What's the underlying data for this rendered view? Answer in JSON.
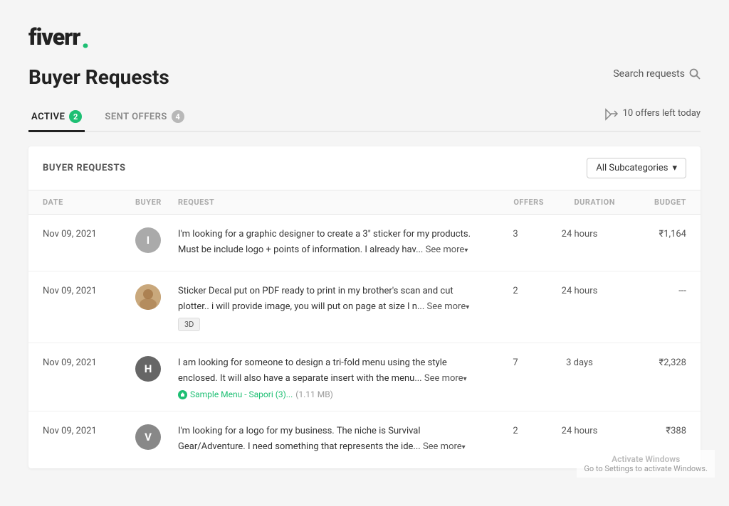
{
  "logo": {
    "text": "fiverr",
    "dot": "."
  },
  "page": {
    "title": "Buyer Requests"
  },
  "search": {
    "placeholder": "Search requests"
  },
  "tabs": [
    {
      "id": "active",
      "label": "ACTIVE",
      "badge": "2",
      "active": true
    },
    {
      "id": "sent-offers",
      "label": "SENT OFFERS",
      "badge": "4",
      "active": false
    }
  ],
  "offers_left": "10 offers left today",
  "table": {
    "title": "BUYER REQUESTS",
    "subcategory_label": "All Subcategories",
    "columns": {
      "date": "DATE",
      "buyer": "BUYER",
      "request": "REQUEST",
      "offers": "OFFERS",
      "duration": "DURATION",
      "budget": "BUDGET"
    },
    "rows": [
      {
        "date": "Nov 09, 2021",
        "buyer_initial": "I",
        "buyer_color": "#aaa",
        "request_text": "I'm looking for a graphic designer to create a 3\" sticker for my products. Must be include logo + points of information. I already hav...",
        "see_more": "See more",
        "tag": null,
        "attachment": null,
        "offers": "3",
        "duration": "24 hours",
        "budget": "₹1,164"
      },
      {
        "date": "Nov 09, 2021",
        "buyer_initial": null,
        "buyer_img": true,
        "buyer_color": "#c9a87c",
        "request_text": "Sticker Decal put on PDF ready to print in my brother's scan and cut plotter.. i will provide image, you will put on page at size I n...",
        "see_more": "See more",
        "tag": "3D",
        "attachment": null,
        "offers": "2",
        "duration": "24 hours",
        "budget": "---"
      },
      {
        "date": "Nov 09, 2021",
        "buyer_initial": "H",
        "buyer_color": "#666",
        "request_text": "I am looking for someone to design a tri-fold menu using the style enclosed. It will also have a separate insert with the menu...",
        "see_more": "See more",
        "tag": null,
        "attachment": {
          "name": "Sample Menu - Sapori (3)...",
          "size": "(1.11 MB)"
        },
        "offers": "7",
        "duration": "3 days",
        "budget": "₹2,328"
      },
      {
        "date": "Nov 09, 2021",
        "buyer_initial": "V",
        "buyer_color": "#888",
        "request_text": "I'm looking for a logo for my business. The niche is Survival Gear/Adventure. I need something that represents the ide...",
        "see_more": "See more",
        "tag": null,
        "attachment": null,
        "offers": "2",
        "duration": "24 hours",
        "budget": "₹388"
      }
    ]
  },
  "activation": {
    "title": "Activate Windows",
    "subtitle": "Go to Settings to activate Windows."
  }
}
